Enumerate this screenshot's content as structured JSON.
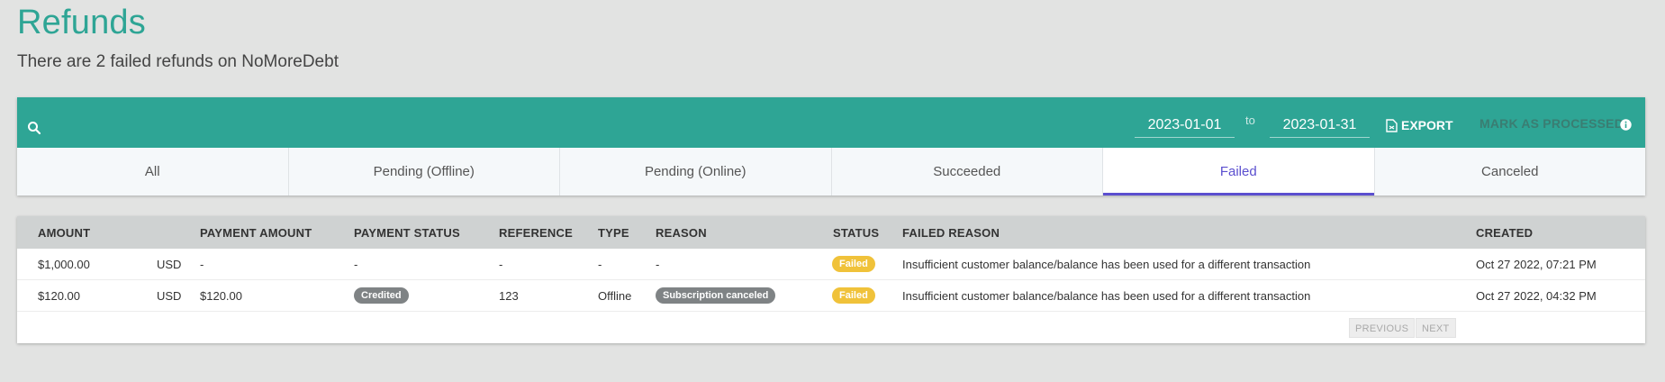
{
  "page": {
    "title": "Refunds",
    "subtitle": "There are 2 failed refunds on NoMoreDebt"
  },
  "toolbar": {
    "date_from": "2023-01-01",
    "to_label": "to",
    "date_to": "2023-01-31",
    "export_label": "EXPORT",
    "mark_processed_label": "MARK AS PROCESSED",
    "icons": {
      "search": "search-icon",
      "export": "file-export-icon",
      "info": "info-icon"
    }
  },
  "tabs": [
    {
      "label": "All",
      "active": false
    },
    {
      "label": "Pending (Offline)",
      "active": false
    },
    {
      "label": "Pending (Online)",
      "active": false
    },
    {
      "label": "Succeeded",
      "active": false
    },
    {
      "label": "Failed",
      "active": true
    },
    {
      "label": "Canceled",
      "active": false
    }
  ],
  "table": {
    "columns": [
      "AMOUNT",
      "PAYMENT AMOUNT",
      "PAYMENT STATUS",
      "REFERENCE",
      "TYPE",
      "REASON",
      "STATUS",
      "FAILED REASON",
      "CREATED"
    ],
    "rows": [
      {
        "amount": "$1,000.00",
        "currency": "USD",
        "payment_amount": "-",
        "payment_status": "-",
        "reference": "-",
        "type": "-",
        "reason": "-",
        "status": "Failed",
        "failed_reason": "Insufficient customer balance/balance has been used for a different transaction",
        "created": "Oct 27 2022, 07:21 PM"
      },
      {
        "amount": "$120.00",
        "currency": "USD",
        "payment_amount": "$120.00",
        "payment_status": "Credited",
        "reference": "123",
        "type": "Offline",
        "reason": "Subscription canceled",
        "status": "Failed",
        "failed_reason": "Insufficient customer balance/balance has been used for a different transaction",
        "created": "Oct 27 2022, 04:32 PM"
      }
    ]
  },
  "pagination": {
    "previous_label": "PREVIOUS",
    "next_label": "NEXT"
  },
  "colors": {
    "brand": "#2ea595",
    "active_tab": "#5b4fcf",
    "badge_failed": "#f0c23a",
    "badge_neutral": "#7f8385"
  }
}
